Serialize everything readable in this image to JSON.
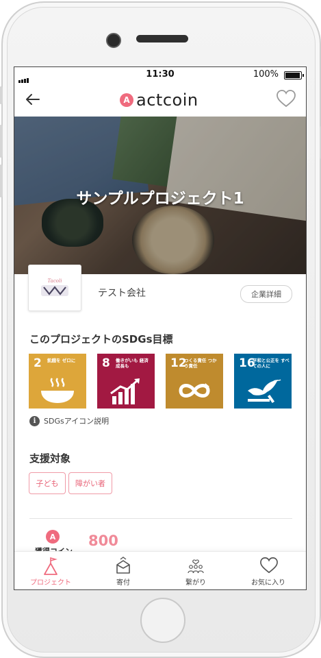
{
  "status_bar": {
    "time": "11:30",
    "battery": "100%"
  },
  "header": {
    "brand": "actcoin",
    "brand_badge": "A"
  },
  "project": {
    "title": "サンプルプロジェクト1"
  },
  "company": {
    "name": "テスト会社",
    "detail_button": "企業詳細",
    "logo_text": "Tacoli"
  },
  "sdgs": {
    "heading": "このプロジェクトのSDGs目標",
    "goals": [
      {
        "number": "2",
        "label": "飢餓を ゼロに",
        "color": "#DDA63A",
        "icon": "bowl-icon"
      },
      {
        "number": "8",
        "label": "働きがいも 経済成長も",
        "color": "#A21942",
        "icon": "growth-chart-icon"
      },
      {
        "number": "12",
        "label": "つくる責任 つかう責任",
        "color": "#BF8B2E",
        "icon": "infinity-icon"
      },
      {
        "number": "16",
        "label": "平和と公正を すべての人に",
        "color": "#00689D",
        "icon": "dove-icon"
      }
    ],
    "help_text": "SDGsアイコン説明"
  },
  "support": {
    "heading": "支援対象",
    "tags": [
      "子ども",
      "障がい者"
    ]
  },
  "coins": {
    "label": "獲得コイン",
    "value": "800"
  },
  "tabs": [
    {
      "label": "プロジェクト",
      "icon": "project-icon",
      "active": true
    },
    {
      "label": "寄付",
      "icon": "donation-icon",
      "active": false
    },
    {
      "label": "繋がり",
      "icon": "connection-icon",
      "active": false
    },
    {
      "label": "お気に入り",
      "icon": "heart-icon",
      "active": false
    }
  ],
  "colors": {
    "accent": "#EF6B7E",
    "tag_border": "#F09AA7"
  }
}
